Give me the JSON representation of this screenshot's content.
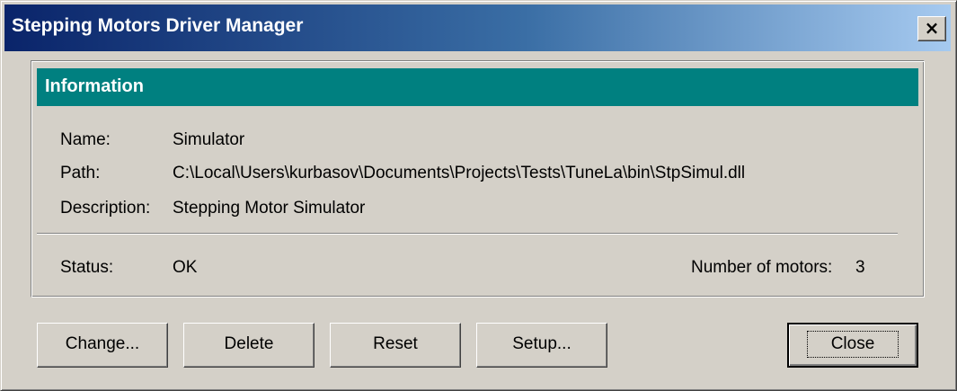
{
  "window": {
    "title": "Stepping Motors Driver Manager",
    "close_glyph": "×",
    "colors": {
      "title_gradient_start": "#0a246a",
      "title_gradient_end": "#a6caf0",
      "face": "#d4d0c8",
      "info_header": "#008080"
    }
  },
  "info": {
    "header": "Information",
    "name_label": "Name:",
    "name_value": "Simulator",
    "path_label": "Path:",
    "path_value": "C:\\Local\\Users\\kurbasov\\Documents\\Projects\\Tests\\TuneLa\\bin\\StpSimul.dll",
    "description_label": "Description:",
    "description_value": "Stepping Motor Simulator",
    "status_label": "Status:",
    "status_value": "OK",
    "motors_label": "Number of motors:",
    "motors_value": "3"
  },
  "buttons": {
    "change": "Change...",
    "delete": "Delete",
    "reset": "Reset",
    "setup": "Setup...",
    "close": "Close"
  }
}
